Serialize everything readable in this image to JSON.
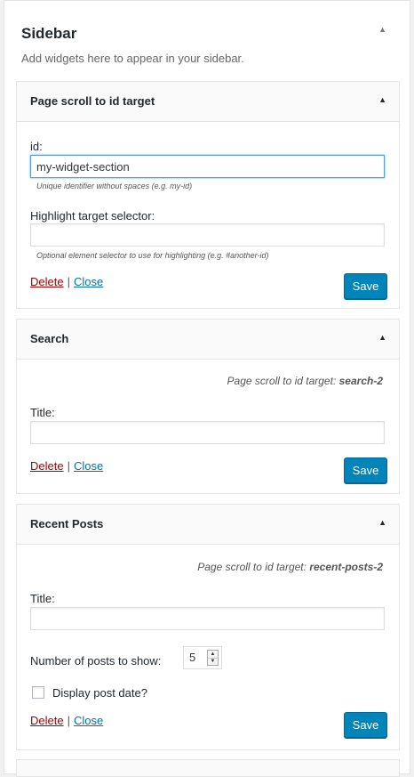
{
  "sidebar": {
    "title": "Sidebar",
    "toggle_icon": "▲",
    "description": "Add widgets here to appear in your sidebar."
  },
  "widgets": [
    {
      "title": "Page scroll to id target",
      "toggle_icon": "▲",
      "id_label": "id:",
      "id_value": "my-widget-section",
      "id_hint": "Unique identifier without spaces (e.g. my-id)",
      "highlight_label": "Highlight target selector:",
      "highlight_value": "",
      "highlight_hint": "Optional element selector to use for highlighting (e.g. #another-id)",
      "delete_label": "Delete",
      "separator": "|",
      "close_label": "Close",
      "save_label": "Save"
    },
    {
      "title": "Search",
      "toggle_icon": "▲",
      "target_prefix": "Page scroll to id target:",
      "target_id": "search-2",
      "title_label": "Title:",
      "title_value": "",
      "delete_label": "Delete",
      "separator": "|",
      "close_label": "Close",
      "save_label": "Save"
    },
    {
      "title": "Recent Posts",
      "toggle_icon": "▲",
      "target_prefix": "Page scroll to id target:",
      "target_id": "recent-posts-2",
      "title_label": "Title:",
      "title_value": "",
      "number_label": "Number of posts to show:",
      "number_value": "5",
      "spin_up": "▲",
      "spin_down": "▼",
      "date_label": "Display post date?",
      "date_checked": false,
      "delete_label": "Delete",
      "separator": "|",
      "close_label": "Close",
      "save_label": "Save"
    }
  ],
  "colors": {
    "primary_button": "#0085ba",
    "delete_link": "#aa0000",
    "close_link": "#0073aa",
    "focus_border": "#5b9dd9"
  }
}
